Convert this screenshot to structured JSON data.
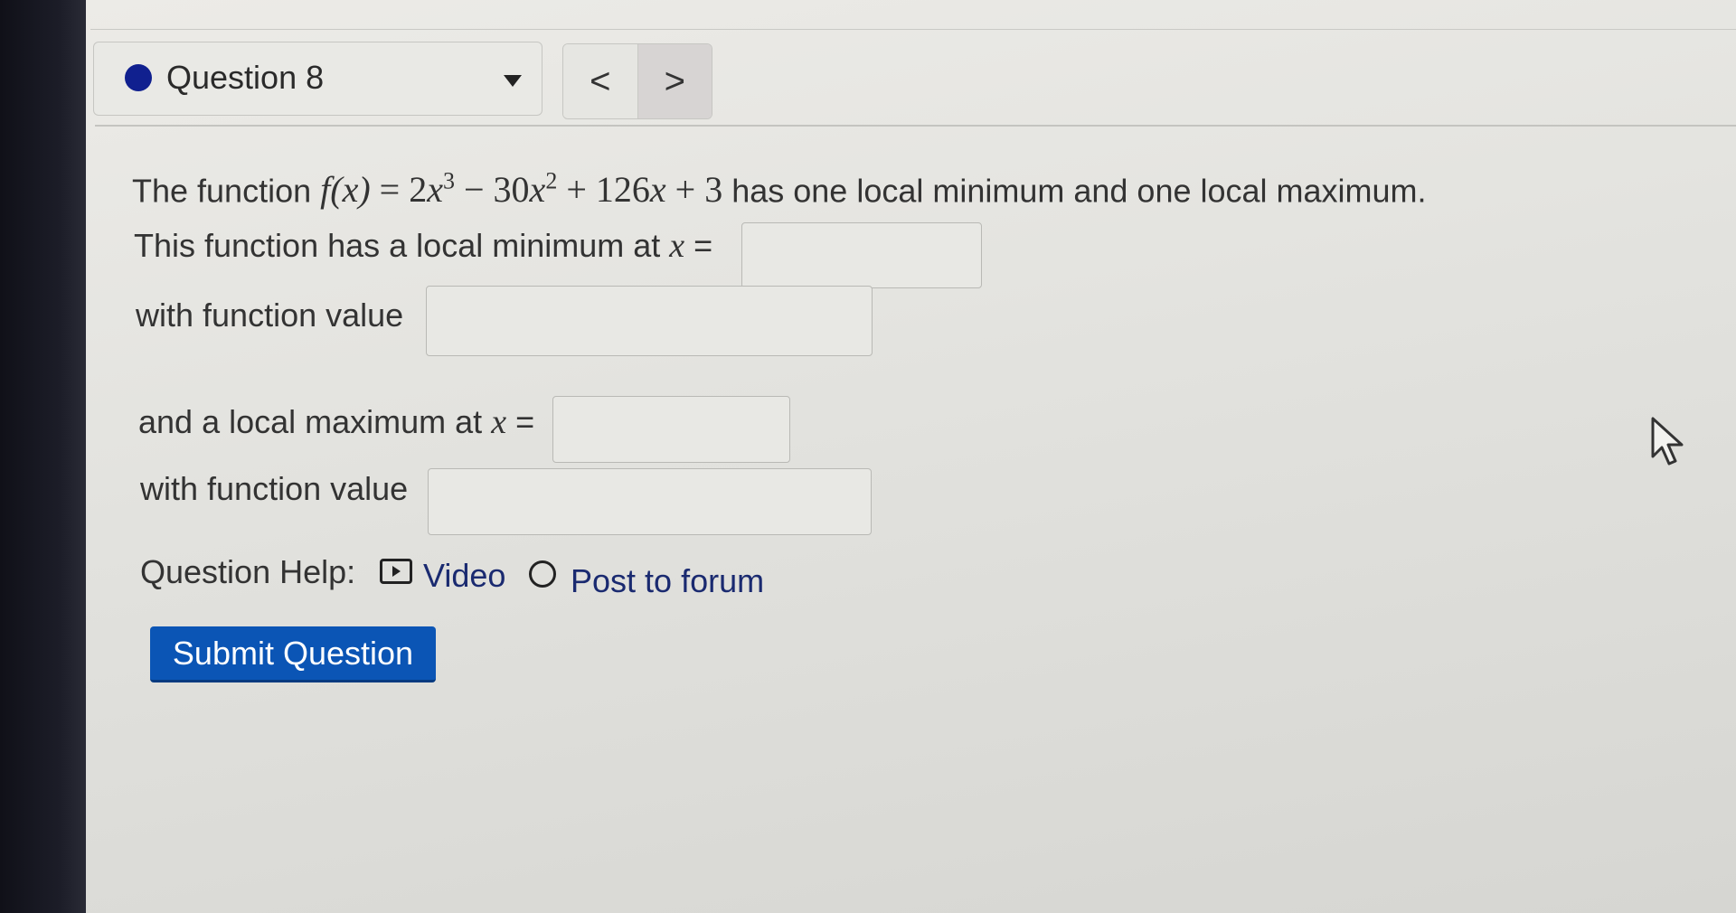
{
  "question_selector": {
    "label": "Question 8",
    "dot_color": "#10208f"
  },
  "navigation": {
    "prev": "<",
    "next": ">"
  },
  "problem": {
    "intro_prefix": "The function",
    "function_lhs": "f(x)",
    "eq": "=",
    "term1_coef": "2",
    "term1_var": "x",
    "term1_exp": "3",
    "op1": "−",
    "term2_coef": "30",
    "term2_var": "x",
    "term2_exp": "2",
    "op2": "+",
    "term3": "126",
    "term3_var": "x",
    "op3": "+",
    "term4": "3",
    "intro_suffix": "has one local minimum and one local maximum.",
    "min_prompt": "This function has a local minimum at",
    "max_prompt": "and a local maximum at",
    "x_var": "x",
    "equals": "=",
    "min_value_label": "with function value",
    "max_value_label": "with function value"
  },
  "answers": {
    "local_min_x": "",
    "local_min_value": "",
    "local_max_x": "",
    "local_max_value": ""
  },
  "help": {
    "label": "Question Help:",
    "video": "Video",
    "forum": "Post to forum"
  },
  "submit_label": "Submit Question",
  "colors": {
    "submit_bg": "#0b55b5",
    "link": "#1a2a70"
  }
}
